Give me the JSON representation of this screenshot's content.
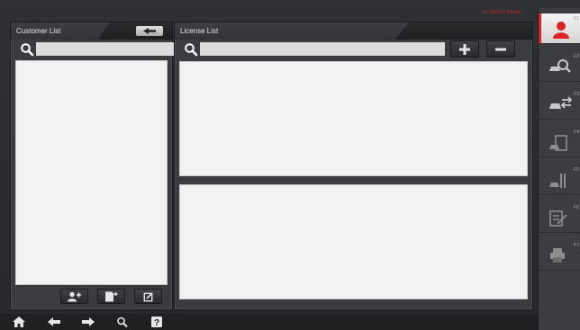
{
  "status": {
    "text": "In Select Mode",
    "color": "#c0262a"
  },
  "customer_panel": {
    "title": "Customer List",
    "search": {
      "value": "",
      "placeholder": ""
    },
    "back_icon": "back-arrow-icon",
    "toolbar": [
      {
        "name": "add-customer-button",
        "icon": "add-person-icon"
      },
      {
        "name": "add-document-button",
        "icon": "add-document-icon"
      },
      {
        "name": "edit-button",
        "icon": "edit-icon"
      }
    ]
  },
  "license_panel": {
    "title": "License List",
    "search": {
      "value": "",
      "placeholder": ""
    },
    "add_icon": "plus-icon",
    "remove_icon": "minus-icon"
  },
  "sidebar": {
    "items": [
      {
        "key": "F1",
        "icon": "person-icon",
        "active": true
      },
      {
        "key": "F2",
        "icon": "car-search-icon",
        "active": false
      },
      {
        "key": "F3",
        "icon": "car-transfer-icon",
        "active": false
      },
      {
        "key": "F4",
        "icon": "clipboard-car-icon",
        "active": false
      },
      {
        "key": "F5",
        "icon": "repair-tools-icon",
        "active": false
      },
      {
        "key": "F6",
        "icon": "edit-list-icon",
        "active": false
      },
      {
        "key": "F7",
        "icon": "printer-icon",
        "active": false
      }
    ]
  },
  "bottom_nav": [
    {
      "name": "home-button",
      "icon": "home-icon"
    },
    {
      "name": "back-button",
      "icon": "arrow-left-icon"
    },
    {
      "name": "forward-button",
      "icon": "arrow-right-icon"
    },
    {
      "name": "zoom-button",
      "icon": "magnifier-icon"
    },
    {
      "name": "help-button",
      "icon": "help-icon"
    }
  ],
  "colors": {
    "accent": "#d22222",
    "panel": "#3a3c3f",
    "list_bg": "#f2f2f2"
  }
}
